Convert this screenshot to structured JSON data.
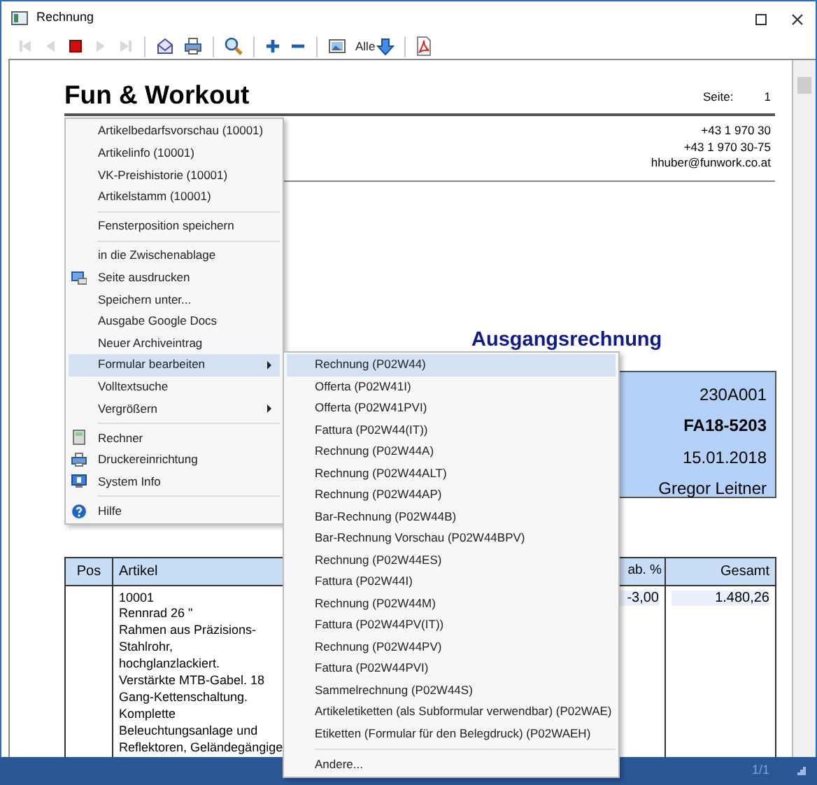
{
  "window": {
    "title": "Rechnung"
  },
  "toolbar": [
    {
      "kind": "first",
      "disabled": true
    },
    {
      "kind": "previous",
      "disabled": true
    },
    {
      "kind": "stop",
      "disabled": false
    },
    {
      "kind": "next",
      "disabled": true
    },
    {
      "kind": "last",
      "disabled": true
    },
    {
      "kind": "separator"
    },
    {
      "kind": "mail",
      "disabled": false
    },
    {
      "kind": "print",
      "disabled": false
    },
    {
      "kind": "separator"
    },
    {
      "kind": "search",
      "disabled": false
    },
    {
      "kind": "separator"
    },
    {
      "kind": "zoom-in",
      "disabled": false
    },
    {
      "kind": "zoom-out",
      "disabled": false
    },
    {
      "kind": "separator"
    },
    {
      "kind": "image",
      "disabled": false
    },
    {
      "kind": "all",
      "label": "Alle",
      "disabled": false
    },
    {
      "kind": "separator"
    },
    {
      "kind": "pdf",
      "disabled": false
    }
  ],
  "document": {
    "company": "Fun & Workout",
    "page_label": "Seite:",
    "page_number": "1",
    "contact_lines": [
      "+43 1 970 30",
      "+43 1 970 30-75",
      "hhuber@funwork.co.at"
    ],
    "title": "Ausgangsrechnung",
    "info_box": [
      {
        "text": "230A001",
        "bold": false
      },
      {
        "text": "FA18-5203",
        "bold": true
      },
      {
        "text": "15.01.2018",
        "bold": false
      },
      {
        "text": "Gregor Leitner",
        "bold": false
      }
    ],
    "table": {
      "columns": [
        "Pos",
        "Artikel",
        "ab. %",
        "Gesamt"
      ],
      "rows": [
        {
          "pos": "",
          "article_lines": [
            "10001",
            "Rennrad 26 \"",
            "Rahmen aus Präzisions-",
            "Stahlrohr,",
            "hochglanzlackiert.",
            "Verstärkte MTB-Gabel. 18",
            "Gang-Kettenschaltung.",
            "Komplette",
            "Beleuchtungsanlage und",
            "Reflektoren, Geländegängige"
          ],
          "discount": "-3,00",
          "total": "1.480,26"
        }
      ]
    }
  },
  "context_menu": [
    {
      "kind": "item",
      "label": "Artikelbedarfsvorschau (10001)",
      "has_submenu": false,
      "selected": false
    },
    {
      "kind": "item",
      "label": "Artikelinfo (10001)",
      "has_submenu": false,
      "selected": false
    },
    {
      "kind": "item",
      "label": "VK-Preishistorie (10001)",
      "has_submenu": false,
      "selected": false
    },
    {
      "kind": "item",
      "label": "Artikelstamm (10001)",
      "has_submenu": false,
      "selected": false
    },
    {
      "kind": "separator"
    },
    {
      "kind": "item",
      "label": "Fensterposition speichern",
      "has_submenu": false,
      "selected": false
    },
    {
      "kind": "separator"
    },
    {
      "kind": "item",
      "label": "in die Zwischenablage",
      "has_submenu": false,
      "selected": false
    },
    {
      "kind": "screen-print",
      "label": "Seite ausdrucken",
      "has_submenu": false,
      "selected": false
    },
    {
      "kind": "item",
      "label": "Speichern unter...",
      "has_submenu": false,
      "selected": false
    },
    {
      "kind": "item",
      "label": "Ausgabe Google Docs",
      "has_submenu": false,
      "selected": false
    },
    {
      "kind": "item",
      "label": "Neuer Archiveintrag",
      "has_submenu": false,
      "selected": false
    },
    {
      "kind": "item",
      "label": "Formular bearbeiten",
      "has_submenu": true,
      "selected": true
    },
    {
      "kind": "item",
      "label": "Volltextsuche",
      "has_submenu": false,
      "selected": false
    },
    {
      "kind": "item",
      "label": "Vergrößern",
      "has_submenu": true,
      "selected": false
    },
    {
      "kind": "separator"
    },
    {
      "kind": "calculator",
      "label": "Rechner",
      "has_submenu": false,
      "selected": false
    },
    {
      "kind": "printer",
      "label": "Druckereinrichtung",
      "has_submenu": false,
      "selected": false
    },
    {
      "kind": "system-info",
      "label": "System Info",
      "has_submenu": false,
      "selected": false
    },
    {
      "kind": "separator"
    },
    {
      "kind": "help",
      "label": "Hilfe",
      "has_submenu": false,
      "selected": false
    }
  ],
  "submenu": [
    {
      "kind": "item",
      "label": "Rechnung (P02W44)",
      "selected": true
    },
    {
      "kind": "item",
      "label": "Offerta (P02W41I)",
      "selected": false
    },
    {
      "kind": "item",
      "label": "Offerta (P02W41PVI)",
      "selected": false
    },
    {
      "kind": "item",
      "label": "Fattura (P02W44(IT))",
      "selected": false
    },
    {
      "kind": "item",
      "label": "Rechnung (P02W44A)",
      "selected": false
    },
    {
      "kind": "item",
      "label": "Rechnung (P02W44ALT)",
      "selected": false
    },
    {
      "kind": "item",
      "label": "Rechnung (P02W44AP)",
      "selected": false
    },
    {
      "kind": "item",
      "label": "Bar-Rechnung (P02W44B)",
      "selected": false
    },
    {
      "kind": "item",
      "label": "Bar-Rechnung Vorschau (P02W44BPV)",
      "selected": false
    },
    {
      "kind": "item",
      "label": "Rechnung (P02W44ES)",
      "selected": false
    },
    {
      "kind": "item",
      "label": "Fattura (P02W44I)",
      "selected": false
    },
    {
      "kind": "item",
      "label": "Rechnung (P02W44M)",
      "selected": false
    },
    {
      "kind": "item",
      "label": "Fattura (P02W44PV(IT))",
      "selected": false
    },
    {
      "kind": "item",
      "label": "Rechnung (P02W44PV)",
      "selected": false
    },
    {
      "kind": "item",
      "label": "Fattura (P02W44PVI)",
      "selected": false
    },
    {
      "kind": "item",
      "label": "Sammelrechnung (P02W44S)",
      "selected": false
    },
    {
      "kind": "item",
      "label": "Artikeletiketten (als Subformular verwendbar) (P02WAE)",
      "selected": false
    },
    {
      "kind": "item",
      "label": "Etiketten (Formular für den Belegdruck) (P02WAEH)",
      "selected": false
    },
    {
      "kind": "separator"
    },
    {
      "kind": "item",
      "label": "Andere...",
      "selected": false
    }
  ],
  "status_bar": {
    "page": "1/1"
  }
}
